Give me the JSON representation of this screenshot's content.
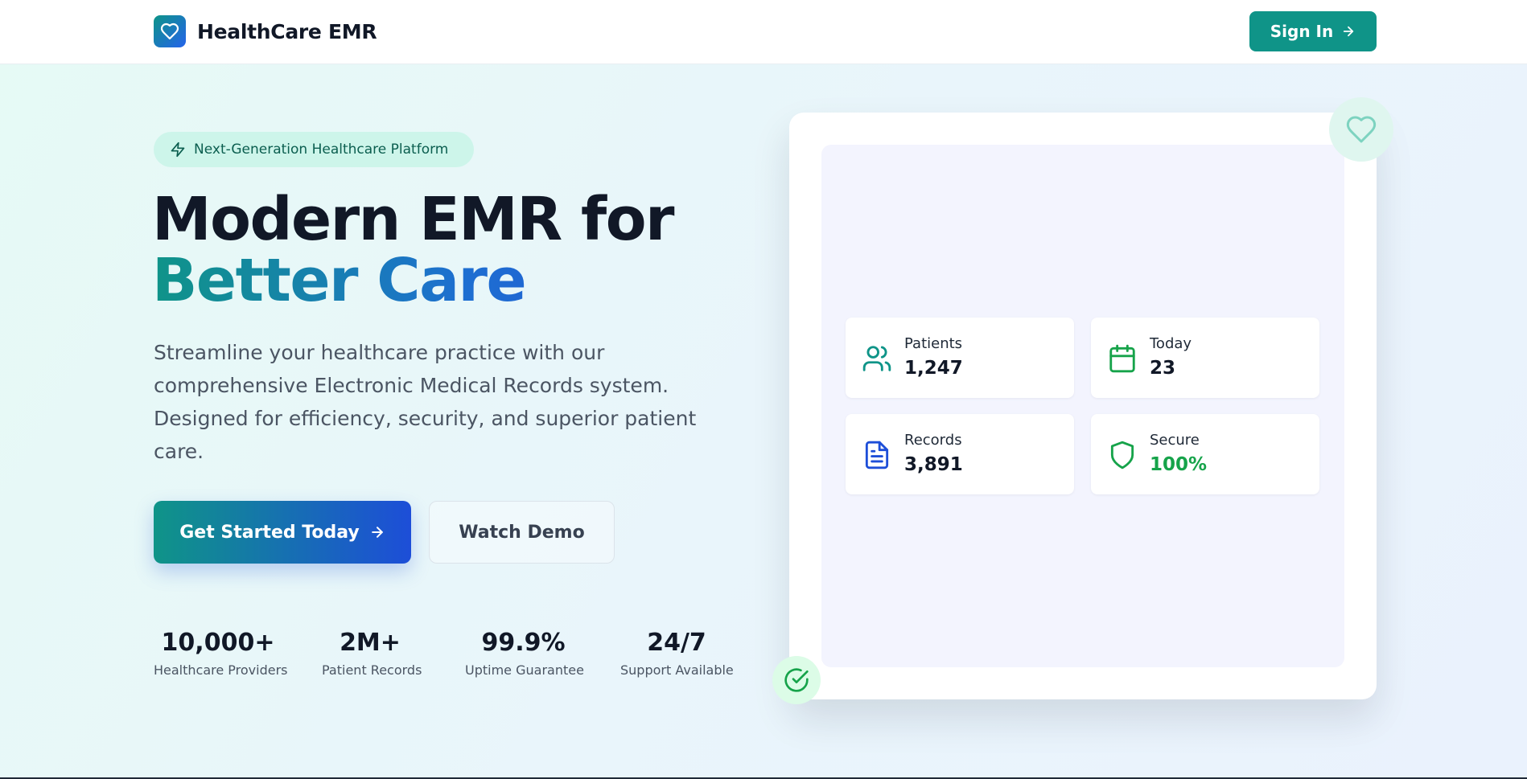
{
  "header": {
    "brand_name": "HealthCare EMR",
    "logo_icon": "heart-icon",
    "sign_in_label": "Sign In"
  },
  "hero": {
    "badge_text": "Next-Generation Healthcare Platform",
    "title_line1": "Modern EMR for",
    "title_line2": "Better Care",
    "description": "Streamline your healthcare practice with our comprehensive Electronic Medical Records system. Designed for efficiency, security, and superior patient care.",
    "primary_cta": "Get Started Today",
    "secondary_cta": "Watch Demo"
  },
  "stats": [
    {
      "value": "10,000+",
      "label": "Healthcare Providers"
    },
    {
      "value": "2M+",
      "label": "Patient Records"
    },
    {
      "value": "99.9%",
      "label": "Uptime Guarantee"
    },
    {
      "value": "24/7",
      "label": "Support Available"
    }
  ],
  "dashboard": {
    "cards": [
      {
        "label": "Patients",
        "value": "1,247",
        "icon": "users-icon"
      },
      {
        "label": "Today",
        "value": "23",
        "icon": "calendar-icon"
      },
      {
        "label": "Records",
        "value": "3,891",
        "icon": "file-text-icon"
      },
      {
        "label": "Secure",
        "value": "100%",
        "icon": "shield-icon"
      }
    ]
  },
  "colors": {
    "brand_teal": "#0f9488",
    "brand_blue": "#1d4ed8",
    "secure_green": "#16a34a",
    "text_dark": "#111827"
  }
}
